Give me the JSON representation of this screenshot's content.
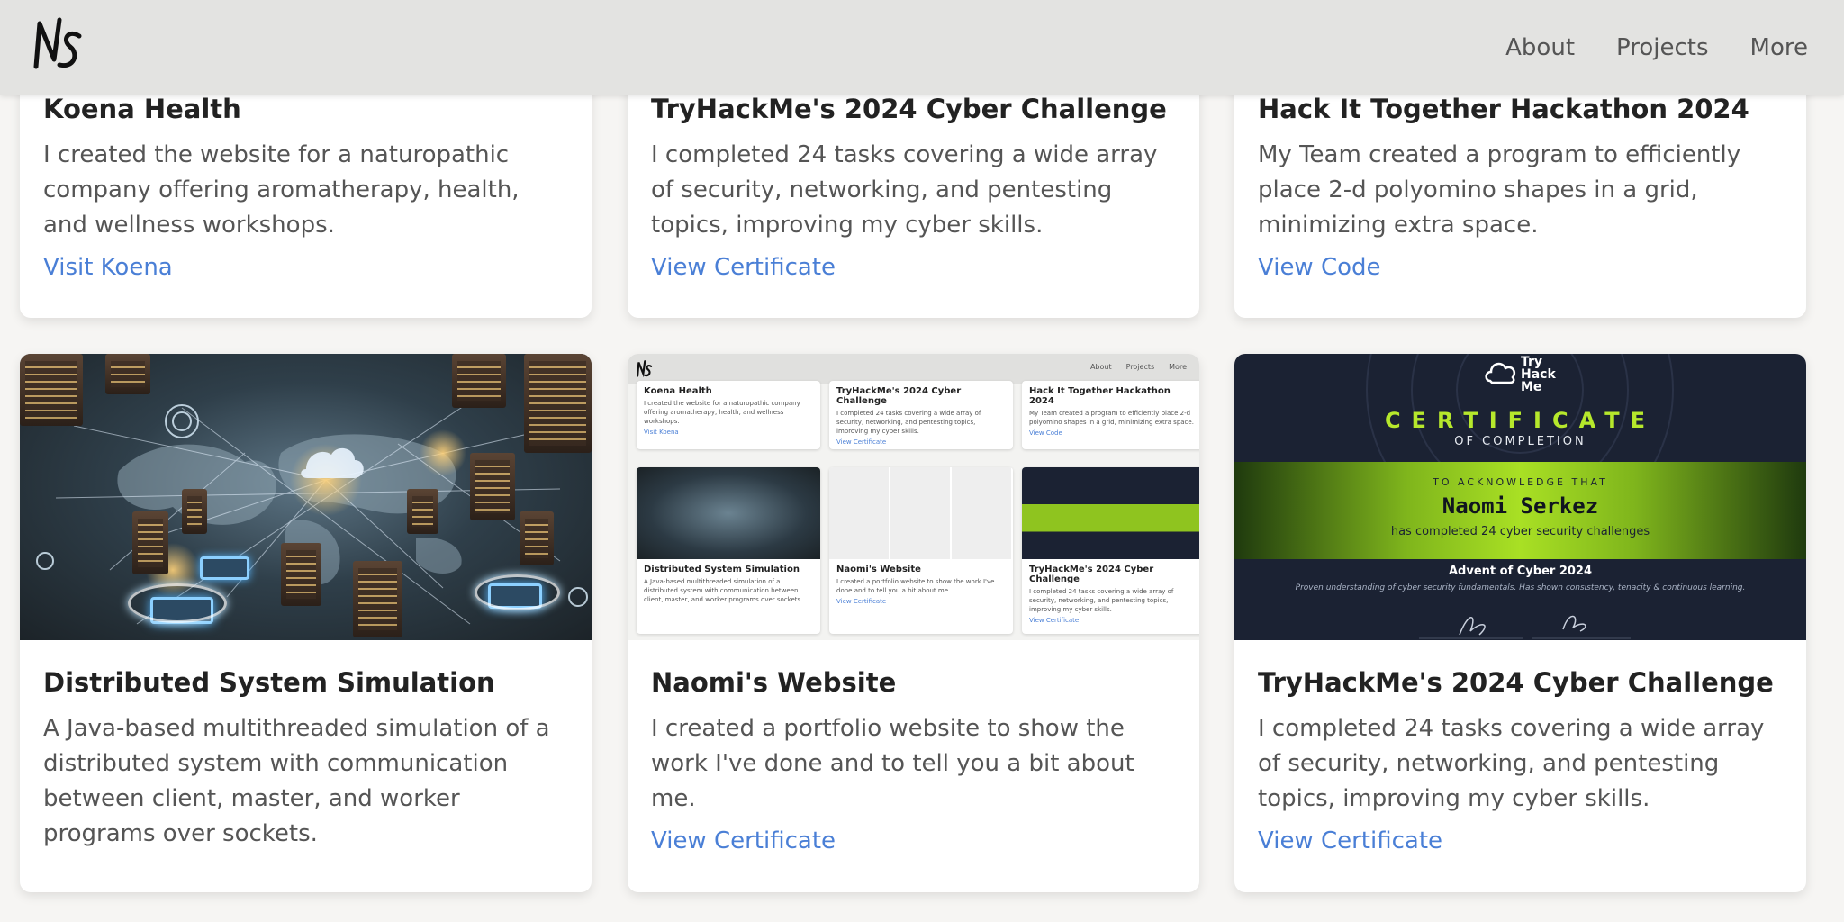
{
  "nav": {
    "logo_text": "NS",
    "links": [
      "About",
      "Projects",
      "More"
    ]
  },
  "cards": [
    {
      "title": "Koena Health",
      "description": "I created the website for a naturopathic company offering aromatherapy, health, and wellness workshops.",
      "link": "Visit Koena"
    },
    {
      "title": "TryHackMe's 2024 Cyber Challenge",
      "description": "I completed 24 tasks covering a wide array of security, networking, and pentesting topics, improving my cyber skills.",
      "link": "View Certificate"
    },
    {
      "title": "Hack It Together Hackathon 2024",
      "description": "My Team created a program to efficiently place 2-d polyomino shapes in a grid, minimizing extra space.",
      "link": "View Code"
    },
    {
      "title": "Distributed System Simulation",
      "description": "A Java-based multithreaded simulation of a distributed system with communication between client, master, and worker programs over sockets.",
      "link": ""
    },
    {
      "title": "Naomi's Website",
      "description": "I created a portfolio website to show the work I've done and to tell you a bit about me.",
      "link": "View Certificate"
    },
    {
      "title": "TryHackMe's 2024 Cyber Challenge",
      "description": "I completed 24 tasks covering a wide array of security, networking, and pentesting topics, improving my cyber skills.",
      "link": "View Certificate"
    }
  ],
  "mini": {
    "links": [
      "About",
      "Projects",
      "More"
    ],
    "cards": [
      {
        "title": "Koena Health",
        "description": "I created the website for a naturopathic company offering aromatherapy, health, and wellness workshops.",
        "link": "Visit Koena"
      },
      {
        "title": "TryHackMe's 2024 Cyber Challenge",
        "description": "I completed 24 tasks covering a wide array of security, networking, and pentesting topics, improving my cyber skills.",
        "link": "View Certificate"
      },
      {
        "title": "Hack It Together Hackathon 2024",
        "description": "My Team created a program to efficiently place 2-d polyomino shapes in a grid, minimizing extra space.",
        "link": "View Code"
      },
      {
        "title": "Distributed System Simulation",
        "description": "A Java-based multithreaded simulation of a distributed system with communication between client, master, and worker programs over sockets.",
        "link": ""
      },
      {
        "title": "Naomi's Website",
        "description": "I created a portfolio website to show the work I've done and to tell you a bit about me.",
        "link": "View Certificate"
      },
      {
        "title": "TryHackMe's 2024 Cyber Challenge",
        "description": "I completed 24 tasks covering a wide array of security, networking, and pentesting topics, improving my cyber skills.",
        "link": "View Certificate"
      }
    ]
  },
  "certificate": {
    "brand_lines": [
      "Try",
      "Hack",
      "Me"
    ],
    "heading": "CERTIFICATE",
    "subheading": "OF COMPLETION",
    "acknowledge": "TO ACKNOWLEDGE THAT",
    "name": "Naomi Serkez",
    "achievement": "has completed 24 cyber security challenges",
    "event": "Advent of Cyber 2024",
    "statement": "Proven understanding of cyber security fundamentals. Has shown consistency, tenacity & continuous learning."
  },
  "colors": {
    "link": "#4a7fd6",
    "navbar": "#e3e3e1",
    "accent_green": "#a9e024"
  }
}
